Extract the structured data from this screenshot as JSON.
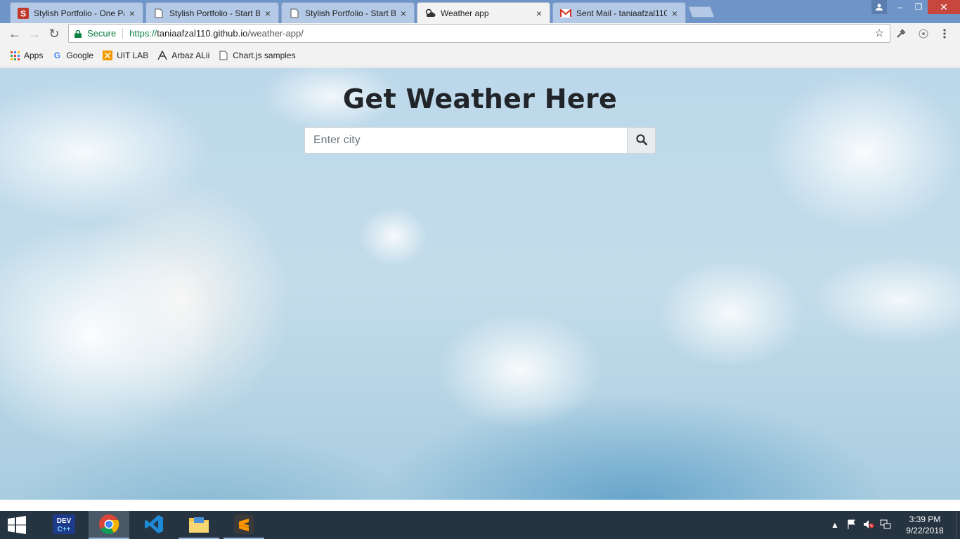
{
  "browser": {
    "tabs": [
      {
        "title": "Stylish Portfolio - One Pa",
        "favicon": "s-logo-icon",
        "active": false
      },
      {
        "title": "Stylish Portfolio - Start Bo",
        "favicon": "page-icon",
        "active": false
      },
      {
        "title": "Stylish Portfolio - Start Bo",
        "favicon": "page-icon",
        "active": false
      },
      {
        "title": "Weather app",
        "favicon": "weather-icon",
        "active": true
      },
      {
        "title": "Sent Mail - taniaafzal110(",
        "favicon": "gmail-icon",
        "active": false
      }
    ],
    "tab_close": "×",
    "window_controls": {
      "minimize": "–",
      "restore": "❐",
      "close": "✕"
    },
    "toolbar": {
      "back": "←",
      "forward": "→",
      "reload": "↻",
      "secure_label": "Secure",
      "url_scheme": "https://",
      "url_host": "taniaafzal110.github.io",
      "url_path": "/weather-app/",
      "star": "☆"
    },
    "bookmarks": [
      {
        "label": "Apps",
        "icon": "apps-grid-icon"
      },
      {
        "label": "Google",
        "icon": "google-icon"
      },
      {
        "label": "UIT LAB",
        "icon": "uit-icon"
      },
      {
        "label": "Arbaz ALii",
        "icon": "arbaz-icon"
      },
      {
        "label": "Chart.js samples",
        "icon": "page-icon"
      }
    ]
  },
  "page": {
    "title": "Get Weather Here",
    "search": {
      "placeholder": "Enter city",
      "value": ""
    },
    "search_button_icon": "search-icon"
  },
  "taskbar": {
    "apps": [
      "windows-start-icon",
      "devc-icon",
      "chrome-icon",
      "vscode-icon",
      "file-explorer-icon",
      "sublime-icon"
    ],
    "clock": {
      "time": "3:39 PM",
      "date": "9/22/2018"
    }
  },
  "colors": {
    "tabstrip": "#6f95c8",
    "secure_green": "#0b8043",
    "heading": "#212529",
    "taskbar": "#263340"
  }
}
